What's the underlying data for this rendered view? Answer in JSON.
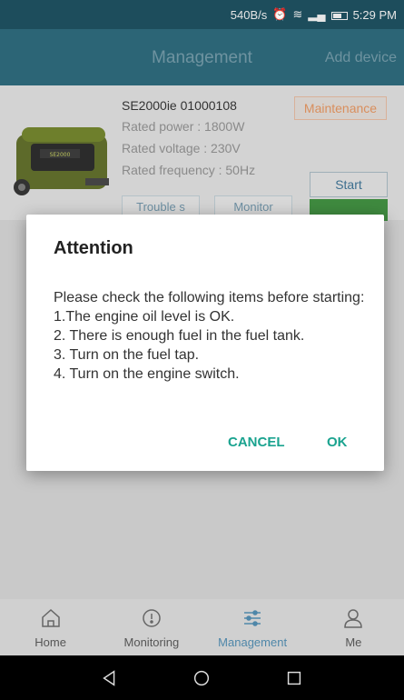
{
  "status_bar": {
    "speed": "540B/s",
    "time": "5:29 PM"
  },
  "header": {
    "title": "Management",
    "add_device": "Add device"
  },
  "device": {
    "name": "SE2000ie 01000108",
    "rated_power": "Rated power : 1800W",
    "rated_voltage": "Rated voltage : 230V",
    "rated_frequency": "Rated frequency : 50Hz",
    "maintenance_label": "Maintenance",
    "start_label": "Start",
    "trouble_label": "Trouble s",
    "monitor_label": "Monitor",
    "generator_badge": "SE2000"
  },
  "dialog": {
    "title": "Attention",
    "intro": "Please check the following items before starting:",
    "items": [
      "1.The engine oil level is OK.",
      "2. There is enough fuel in the fuel tank.",
      "3. Turn on the fuel tap.",
      "4. Turn on the engine switch."
    ],
    "cancel_label": "CANCEL",
    "ok_label": "OK"
  },
  "bottom_nav": [
    {
      "label": "Home",
      "icon": "home-icon",
      "active": false
    },
    {
      "label": "Monitoring",
      "icon": "monitoring-icon",
      "active": false
    },
    {
      "label": "Management",
      "icon": "sliders-icon",
      "active": true
    },
    {
      "label": "Me",
      "icon": "person-icon",
      "active": false
    }
  ],
  "colors": {
    "header": "#2c6576",
    "accent": "#1aa38f",
    "maintenance": "#d98e5c",
    "active_nav": "#4f87a9"
  }
}
